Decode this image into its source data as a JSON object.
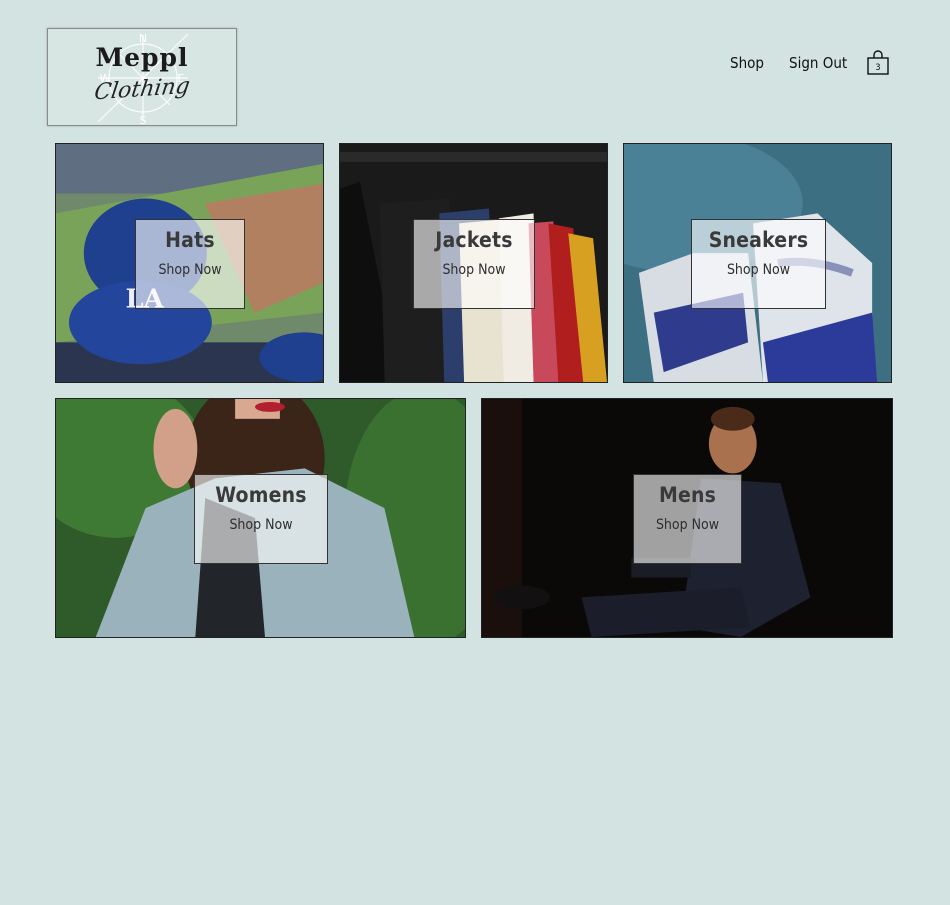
{
  "header": {
    "logo": {
      "brand": "Meppl",
      "script": "Clothing",
      "compass": [
        "N",
        "E",
        "S",
        "W"
      ]
    },
    "nav": {
      "shop": "Shop",
      "sign_out": "Sign Out"
    },
    "cart": {
      "count": "3",
      "icon": "shopping-bag-icon"
    }
  },
  "categories": [
    {
      "title": "Hats",
      "cta": "Shop Now",
      "image": "baseball-cap-photo"
    },
    {
      "title": "Jackets",
      "cta": "Shop Now",
      "image": "clothing-rack-photo"
    },
    {
      "title": "Sneakers",
      "cta": "Shop Now",
      "image": "sneakers-photo"
    },
    {
      "title": "Womens",
      "cta": "Shop Now",
      "image": "woman-in-coat-photo"
    },
    {
      "title": "Mens",
      "cta": "Shop Now",
      "image": "man-in-suit-photo"
    }
  ],
  "colors": {
    "background": "#d2e3e1",
    "card_overlay": "#ffffff"
  }
}
